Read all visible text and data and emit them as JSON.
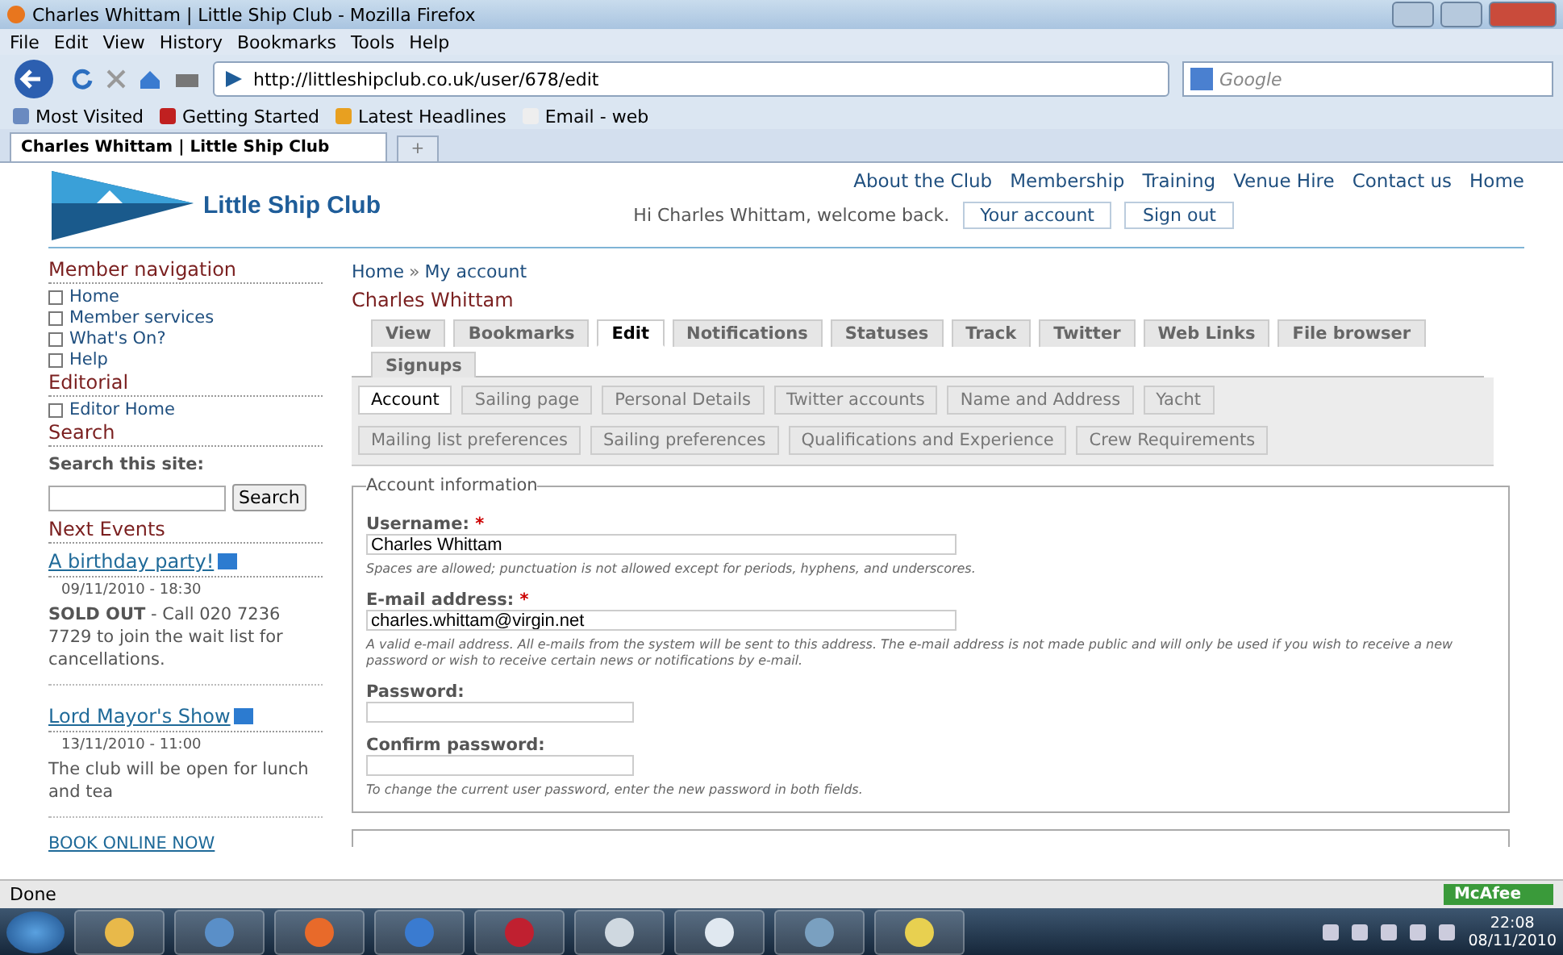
{
  "browser": {
    "title": "Charles Whittam | Little Ship Club - Mozilla Firefox",
    "menu": [
      "File",
      "Edit",
      "View",
      "History",
      "Bookmarks",
      "Tools",
      "Help"
    ],
    "url": "http://littleshipclub.co.uk/user/678/edit",
    "search_placeholder": "Google",
    "bookmarks": [
      "Most Visited",
      "Getting Started",
      "Latest Headlines",
      "Email - web"
    ],
    "tabs": [
      {
        "label": "Charles Whittam | Little Ship Club",
        "selected": true
      }
    ],
    "new_tab": "+"
  },
  "site": {
    "name": "Little Ship Club",
    "top_links": [
      "About the Club",
      "Membership",
      "Training",
      "Venue Hire",
      "Contact us",
      "Home"
    ],
    "greeting": "Hi Charles Whittam, welcome back.",
    "account_buttons": [
      "Your account",
      "Sign out"
    ]
  },
  "sidebar": {
    "member_nav": {
      "heading": "Member navigation",
      "items": [
        "Home",
        "Member services",
        "What's On?",
        "Help"
      ]
    },
    "editorial": {
      "heading": "Editorial",
      "items": [
        "Editor Home"
      ]
    },
    "search": {
      "heading": "Search",
      "label": "Search this site:",
      "button": "Search"
    },
    "events": {
      "heading": "Next Events",
      "items": [
        {
          "title": "A birthday party!",
          "date": "09/11/2010 - 18:30",
          "text": "**SOLD OUT** - Call 020 7236 7729 to  join the wait list for cancellations."
        },
        {
          "title": "Lord Mayor's Show",
          "date": "13/11/2010 - 11:00",
          "text": " The club will be open for lunch and tea"
        }
      ],
      "book_link": "BOOK ONLINE NOW"
    }
  },
  "main": {
    "breadcrumb": [
      "Home",
      "My account"
    ],
    "breadcrumb_sep": "»",
    "title": "Charles Whittam",
    "tabs": [
      {
        "label": "View",
        "selected": false
      },
      {
        "label": "Bookmarks",
        "selected": false
      },
      {
        "label": "Edit",
        "selected": true
      },
      {
        "label": "Notifications",
        "selected": false
      },
      {
        "label": "Statuses",
        "selected": false
      },
      {
        "label": "Track",
        "selected": false
      },
      {
        "label": "Twitter",
        "selected": false
      },
      {
        "label": "Web Links",
        "selected": false
      },
      {
        "label": "File browser",
        "selected": false
      },
      {
        "label": "Signups",
        "selected": false
      }
    ],
    "subtabs": [
      {
        "label": "Account",
        "selected": true
      },
      {
        "label": "Sailing page",
        "selected": false
      },
      {
        "label": "Personal Details",
        "selected": false
      },
      {
        "label": "Twitter accounts",
        "selected": false
      },
      {
        "label": "Name and Address",
        "selected": false
      },
      {
        "label": "Yacht",
        "selected": false
      },
      {
        "label": "Mailing list preferences",
        "selected": false
      },
      {
        "label": "Sailing preferences",
        "selected": false
      },
      {
        "label": "Qualifications and Experience",
        "selected": false
      },
      {
        "label": "Crew Requirements",
        "selected": false
      }
    ],
    "fieldset": {
      "legend": "Account information",
      "fields": [
        {
          "label": "Username:",
          "required": true,
          "value": "Charles Whittam",
          "help": "Spaces are allowed; punctuation is not allowed except for periods, hyphens, and underscores."
        },
        {
          "label": "E-mail address:",
          "required": true,
          "value": "charles.whittam@virgin.net",
          "help": "A valid e-mail address. All e-mails from the system will be sent to this address. The e-mail address is not made public and will only be used if you wish to receive a new password or wish to receive certain news or notifications by e-mail."
        },
        {
          "label": "Password:",
          "required": false
        },
        {
          "label": "Confirm password:",
          "required": false,
          "help": "To change the current user password, enter the new password in both fields."
        }
      ],
      "required_mark": "*"
    }
  },
  "status_bar": {
    "text": "Done",
    "badge": "McAfee"
  },
  "taskbar": {
    "time": "22:08",
    "date": "08/11/2010"
  }
}
